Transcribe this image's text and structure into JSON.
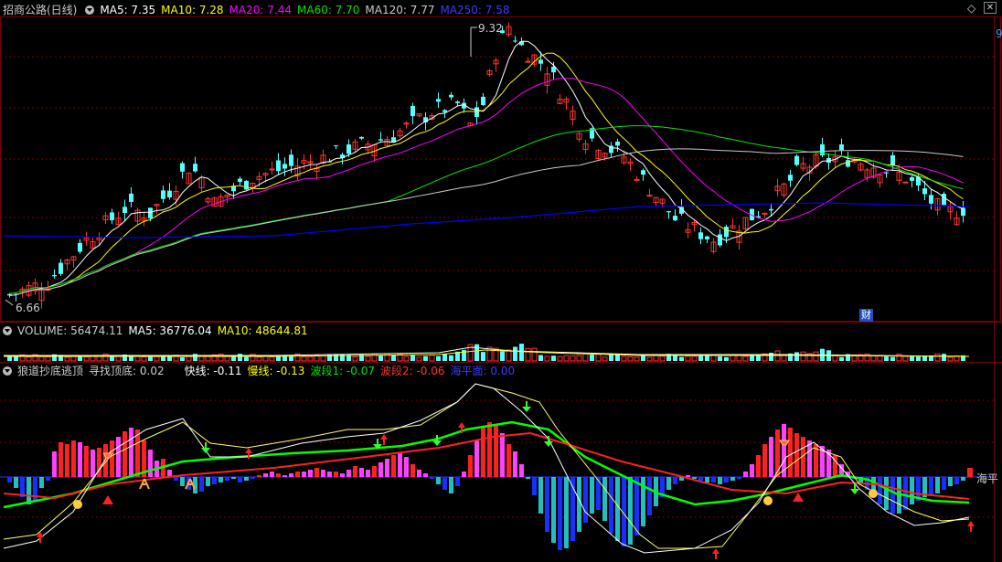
{
  "main_header": {
    "title": "招商公路(日线)",
    "ma5": "MA5: 7.35",
    "ma10": "MA10: 7.28",
    "ma20": "MA20: 7.44",
    "ma60": "MA60: 7.70",
    "ma120": "MA120: 7.77",
    "ma250": "MA250: 7.58"
  },
  "price_labels": {
    "high": "9.32",
    "low": "6.66",
    "cai": "财"
  },
  "volume_header": {
    "title": "VOLUME: 56474.11",
    "ma5": "MA5: 36776.04",
    "ma10": "MA10: 48644.81"
  },
  "indicator_header": {
    "title": "狼道抄底逃顶",
    "xzdd": "寻找顶底: 0.02",
    "fast": "快线: -0.11",
    "slow": "慢线: -0.13",
    "wave1": "波段1: -0.07",
    "wave2": "波段2: -0.06",
    "sea": "海平面: 0.00"
  },
  "sea_label": "海平",
  "corner_icons": {
    "diamond": "◇",
    "close": "✕",
    "side": "9"
  },
  "colors": {
    "up": "#ff3232",
    "down": "#54ffff",
    "ma5": "#ffffff",
    "ma10": "#ffff00",
    "ma20": "#ff00ff",
    "ma60": "#00e600",
    "ma120": "#c8c8c8",
    "ma250": "#0000ff",
    "grid": "#7a0000",
    "hist_red": "#ff2020",
    "hist_magenta": "#ff40ff",
    "hist_blue": "#1830ff",
    "hist_cyan": "#20c0c0"
  },
  "chart_data": {
    "type": "candlestick",
    "price_high": 9.32,
    "price_low": 6.66,
    "candles_note": "daily candlesticks with MA overlays",
    "ma_lines": [
      "MA5",
      "MA10",
      "MA20",
      "MA60",
      "MA120",
      "MA250"
    ]
  }
}
